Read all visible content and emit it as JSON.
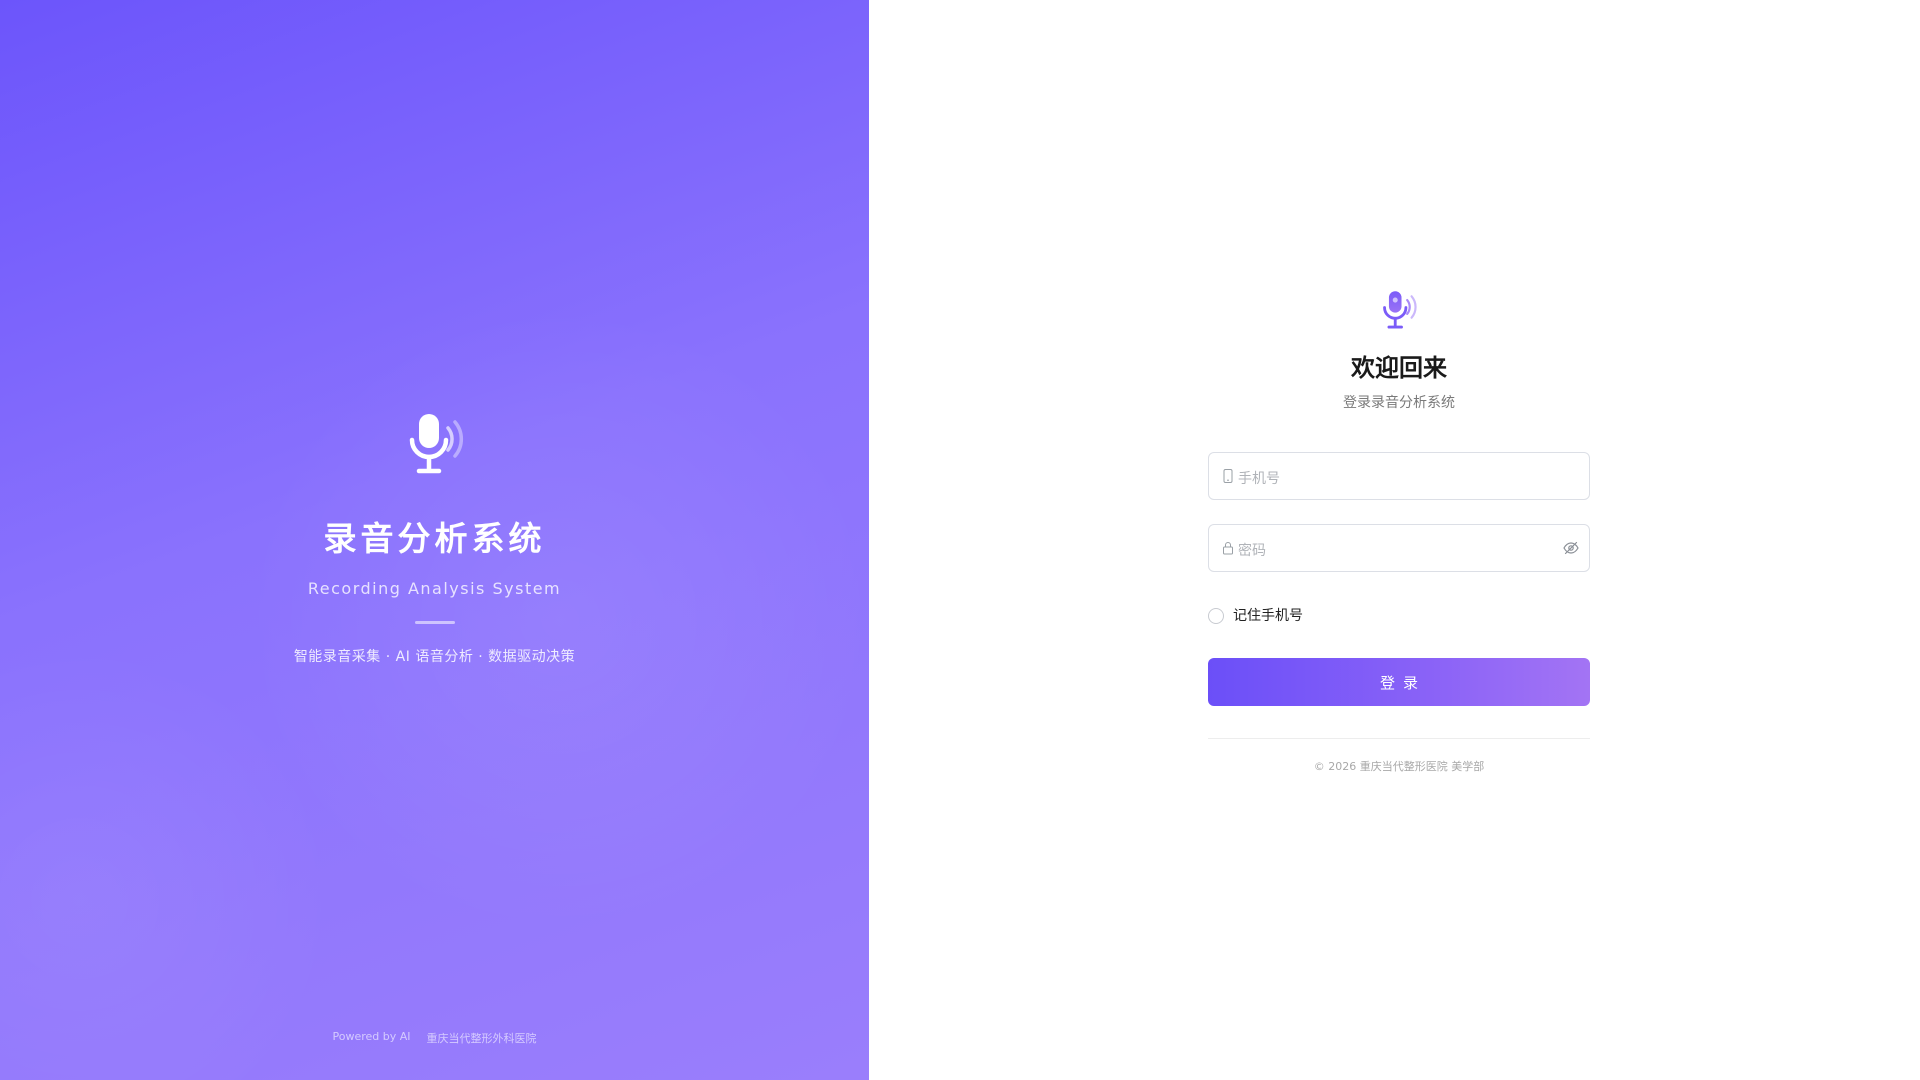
{
  "brand": {
    "title": "录音分析系统",
    "subtitle": "Recording Analysis System",
    "tagline": "智能录音采集 · AI 语音分析 · 数据驱动决策",
    "footer_powered": "Powered by AI",
    "footer_org": "重庆当代整形外科医院",
    "logo_icon": "microphone-waves-icon",
    "colors": {
      "gradient_start": "#6c55fb",
      "gradient_end": "#9a7efc"
    }
  },
  "login": {
    "title": "欢迎回来",
    "subtitle": "登录录音分析系统",
    "logo_icon": "microphone-waves-icon",
    "phone": {
      "placeholder": "手机号",
      "value": "",
      "icon": "phone-icon"
    },
    "password": {
      "placeholder": "密码",
      "value": "",
      "icon": "lock-icon",
      "toggle_icon": "eye-off-icon"
    },
    "remember_label": "记住手机号",
    "remember_checked": false,
    "submit_label": "登录",
    "copyright": "© 2026 重庆当代整形医院 美学部",
    "colors": {
      "accent": "#6b4ff8",
      "accent_end": "#a374f4"
    }
  }
}
